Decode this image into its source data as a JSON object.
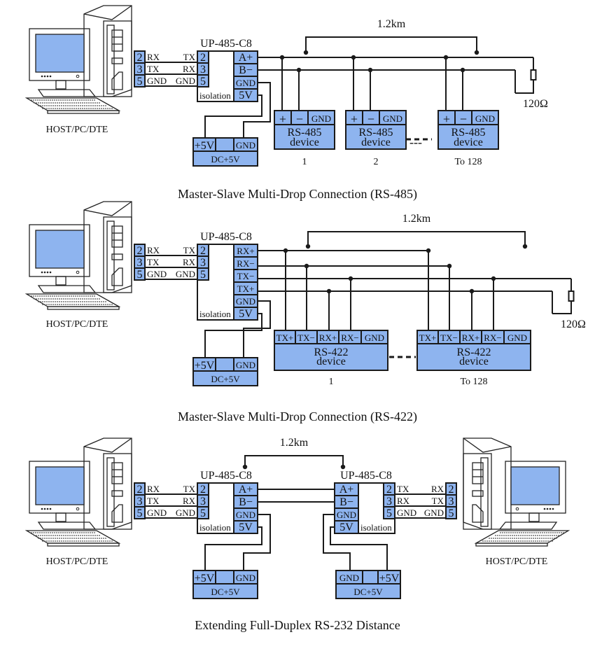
{
  "colors": {
    "accent_blue": "#8eb4ef",
    "line": "#1a1a1a",
    "background": "#ffffff"
  },
  "host_label": "HOST/PC/DTE",
  "converter_name": "UP-485-C8",
  "isolation_label": "isolation",
  "db9": {
    "pins": [
      "2",
      "3",
      "5"
    ],
    "pc_side": [
      "RX",
      "TX",
      "GND"
    ],
    "conv_side": [
      "TX",
      "RX",
      "GND"
    ]
  },
  "power": {
    "plus": "+5V",
    "gnd": "GND",
    "label": "DC+5V",
    "conv_gnd": "GND",
    "conv_5v": "5V"
  },
  "distance_label": "1.2km",
  "terminator_label": "120Ω",
  "section1": {
    "caption": "Master-Slave Multi-Drop Connection (RS-485)",
    "outputs": [
      "A+",
      "B−"
    ],
    "device": {
      "pins": [
        "+",
        "−",
        "GND"
      ],
      "line1": "RS-485",
      "line2": "device"
    },
    "device_numbers": [
      "1",
      "2",
      "To 128"
    ],
    "ellipsis": "---"
  },
  "section2": {
    "caption": "Master-Slave Multi-Drop Connection (RS-422)",
    "outputs": [
      "RX+",
      "RX−",
      "TX−",
      "TX+"
    ],
    "device": {
      "pins": [
        "TX+",
        "TX−",
        "RX+",
        "RX−",
        "GND"
      ],
      "line1": "RS-422",
      "line2": "device"
    },
    "device_numbers": [
      "1",
      "To 128"
    ],
    "ellipsis": "---"
  },
  "section3": {
    "caption": "Extending Full-Duplex  RS-232 Distance",
    "outputs": [
      "A+",
      "B−"
    ],
    "right_db9": {
      "pins": [
        "2",
        "3",
        "5"
      ],
      "conv_side": [
        "TX",
        "RX",
        "GND"
      ],
      "pc_side": [
        "RX",
        "TX",
        "GND"
      ]
    }
  }
}
